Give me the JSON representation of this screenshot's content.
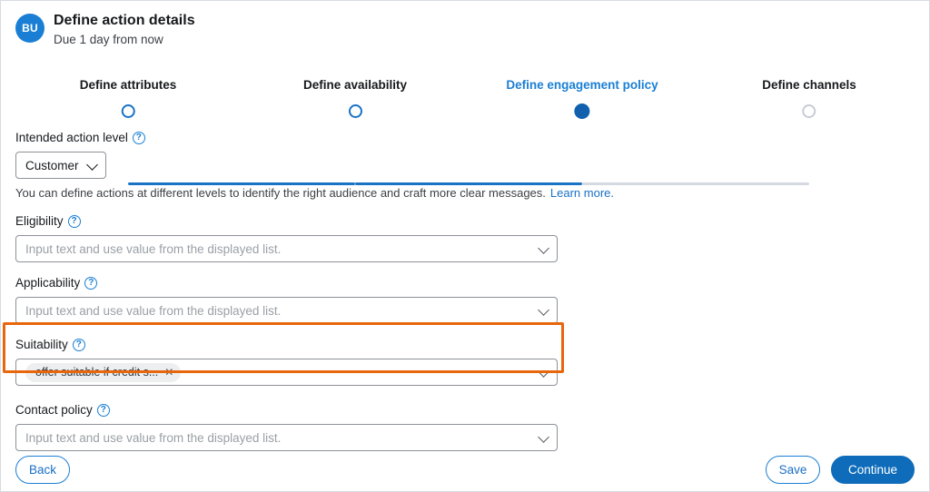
{
  "header": {
    "avatar_initials": "BU",
    "title": "Define action details",
    "subtitle": "Due 1 day from now"
  },
  "stepper": {
    "steps": [
      {
        "label": "Define attributes",
        "state": "completed"
      },
      {
        "label": "Define availability",
        "state": "completed"
      },
      {
        "label": "Define engagement policy",
        "state": "current"
      },
      {
        "label": "Define channels",
        "state": "upcoming"
      }
    ],
    "accent_color": "#1a73c4",
    "inactive_color": "#d5d9e0"
  },
  "form": {
    "intended_action_level": {
      "label": "Intended action level",
      "help_icon": "question-mark-icon",
      "value": "Customer",
      "hint": "You can define actions at different levels to identify the right audience and craft more clear messages.",
      "hint_link": "Learn more."
    },
    "eligibility": {
      "label": "Eligibility",
      "help_icon": "question-mark-icon",
      "placeholder": "Input text and use value from the displayed list."
    },
    "applicability": {
      "label": "Applicability",
      "help_icon": "question-mark-icon",
      "placeholder": "Input text and use value from the displayed list."
    },
    "suitability": {
      "label": "Suitability",
      "help_icon": "question-mark-icon",
      "chip": "offer suitable if credit s...",
      "chip_remove_icon": "close-icon",
      "highlight_color": "#e8670c"
    },
    "contact_policy": {
      "label": "Contact policy",
      "help_icon": "question-mark-icon",
      "placeholder": "Input text and use value from the displayed list."
    }
  },
  "footer": {
    "back": "Back",
    "save": "Save",
    "continue": "Continue"
  }
}
